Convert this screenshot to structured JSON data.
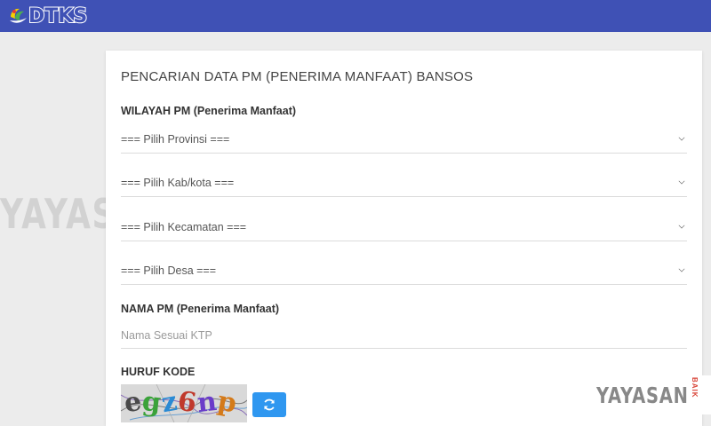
{
  "header": {
    "logo_text": "DTKS",
    "logo_icon": "dtks-leaf-logo-icon",
    "bar_color": "#3f51b5"
  },
  "watermark": {
    "main": "YAYASAN",
    "sub": "BAIK"
  },
  "form": {
    "title": "PENCARIAN DATA PM (PENERIMA MANFAAT) BANSOS",
    "wilayah_label": "WILAYAH PM (Penerima Manfaat)",
    "provinsi": "=== Pilih Provinsi ===",
    "kabkota": "=== Pilih Kab/kota ===",
    "kecamatan": "=== Pilih Kecamatan ===",
    "desa": "=== Pilih Desa ===",
    "nama_label": "NAMA PM (Penerima Manfaat)",
    "nama_placeholder": "Nama Sesuai KTP",
    "nama_value": "",
    "kode_label": "HURUF KODE",
    "captcha_chars": [
      "e",
      "g",
      "z",
      "6",
      "n",
      "p"
    ],
    "captcha_colors": [
      "#4a4a4a",
      "#3aa23a",
      "#2a8ad4",
      "#c0392b",
      "#6a3cc9",
      "#d47a1a"
    ],
    "refresh_icon": "refresh-icon",
    "accent_color": "#2f97f0"
  }
}
